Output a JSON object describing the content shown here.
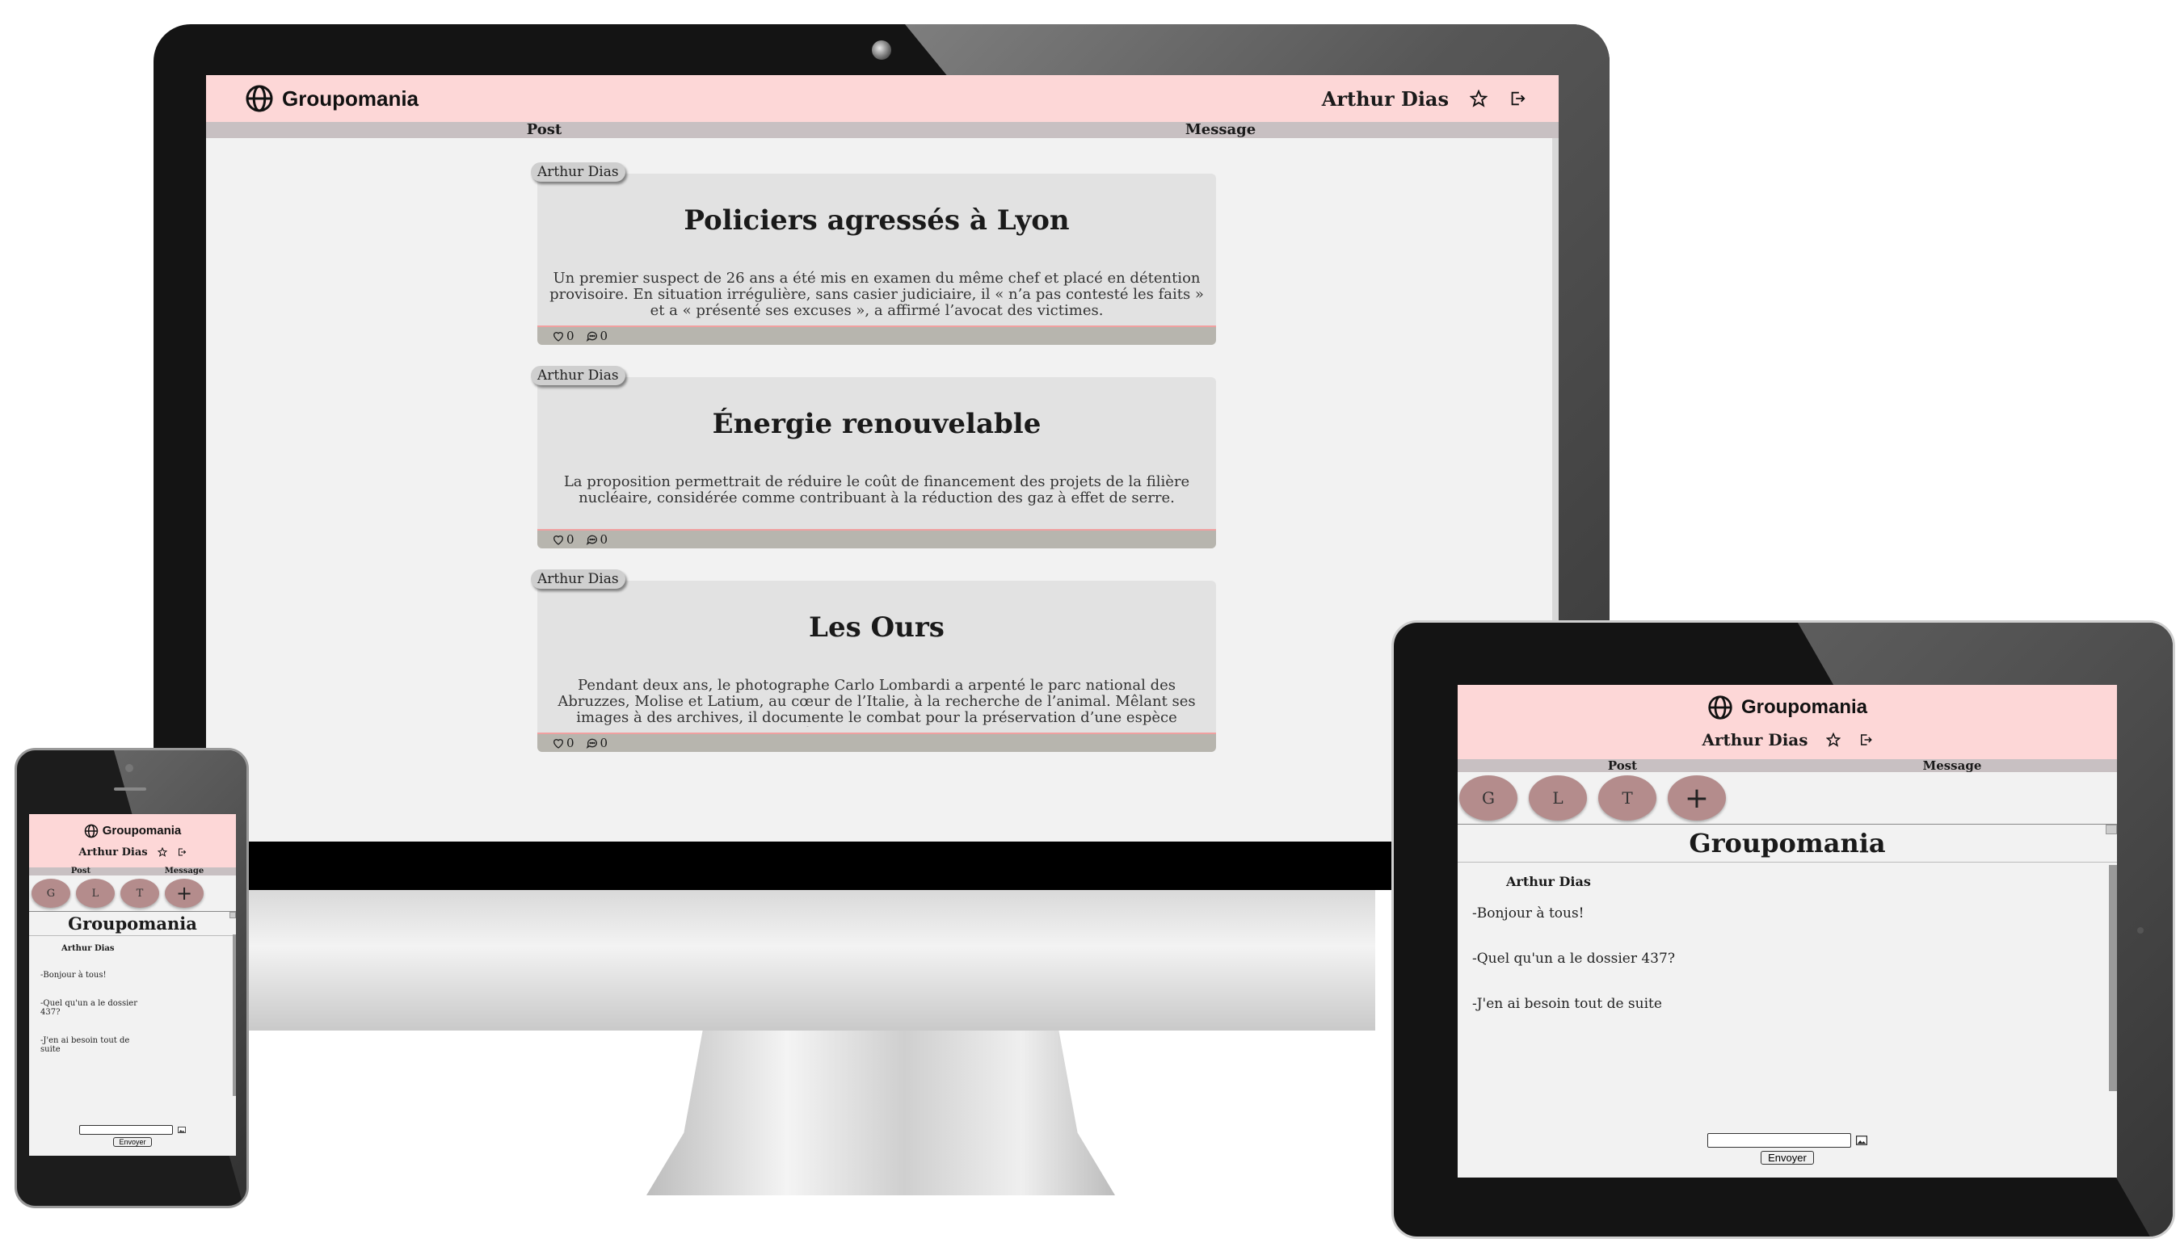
{
  "app": {
    "brand": "Groupomania",
    "user": "Arthur Dias",
    "nav": {
      "post": "Post",
      "message": "Message"
    }
  },
  "feed": {
    "posts": [
      {
        "author": "Arthur Dias",
        "title": "Policiers agressés à Lyon",
        "body": "Un premier suspect de 26 ans a été mis en examen du même chef et placé en détention provisoire. En situation irrégulière, sans casier judiciaire, il « n’a pas contesté les faits » et a « présenté ses excuses », a affirmé l’avocat des victimes.",
        "likes": "0",
        "comments": "0"
      },
      {
        "author": "Arthur Dias",
        "title": "Énergie renouvelable",
        "body": "La proposition permettrait de réduire le coût de financement des projets de la filière nucléaire, considérée comme contribuant à la réduction des gaz à effet de serre.",
        "likes": "0",
        "comments": "0"
      },
      {
        "author": "Arthur Dias",
        "title": "Les Ours",
        "body": "Pendant deux ans, le photographe Carlo Lombardi a arpenté le parc national des Abruzzes, Molise et Latium, au cœur de l’Italie, à la recherche de l’animal. Mêlant ses images à des archives, il documente le combat pour la préservation d’une espèce désormais en « danger",
        "likes": "0",
        "comments": "0"
      }
    ]
  },
  "chat": {
    "groups": [
      "G",
      "L",
      "T"
    ],
    "add": "+",
    "title": "Groupomania",
    "author": "Arthur Dias",
    "messages": [
      "-Bonjour à tous!",
      "-Quel qu'un a le dossier 437?",
      "-J'en ai besoin tout de suite"
    ],
    "send_label": "Envoyer"
  },
  "icons": {
    "brand": "globe-icon",
    "favorite": "star-icon",
    "logout": "logout-icon",
    "like": "heart-icon",
    "comment": "comment-icon",
    "attach": "image-icon"
  },
  "colors": {
    "header": "#fdd7d7",
    "nav": "#c8c0c2",
    "card": "#e2e2e2",
    "card_bar": "#b7b5ae",
    "group_circle": "#b48c8c"
  }
}
